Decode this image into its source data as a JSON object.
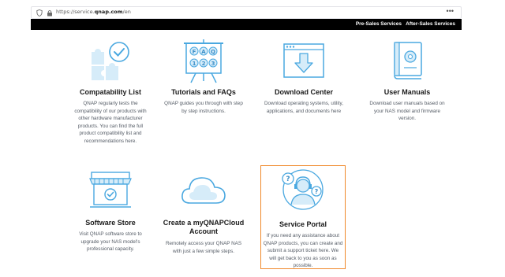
{
  "browser": {
    "url_prefix": "https://service.",
    "url_domain": "qnap.com",
    "url_path": "/en",
    "menu_glyph": "•••"
  },
  "topnav": {
    "pre_sales": "Pre-Sales Services",
    "after_sales": "After-Sales Services"
  },
  "cards": [
    {
      "title": "Compatability List",
      "icon": "puzzle-check-icon",
      "desc": [
        "QNAP regularly tests the",
        "compatibility of our products with",
        "other hardware manufacturer",
        "products. You can find the full",
        "product compatibility list and",
        "recommendations here."
      ]
    },
    {
      "title": "Tutorials and FAQs",
      "icon": "faq-board-icon",
      "desc": [
        "QNAP guides you through with step",
        "by step instructions."
      ]
    },
    {
      "title": "Download Center",
      "icon": "download-window-icon",
      "desc": [
        "Download operating systems, utility,",
        "applications, and documents here"
      ]
    },
    {
      "title": "User Manuals",
      "icon": "manual-book-icon",
      "desc": [
        "Download user manuals based on",
        "your NAS model and firmware",
        "version."
      ]
    },
    {
      "title": "Software Store",
      "icon": "store-icon",
      "desc": [
        "Visit QNAP software store to",
        "upgrade your NAS model's",
        "professional capacity."
      ]
    },
    {
      "title_lines": [
        "Create a myQNAPCloud",
        "Account"
      ],
      "icon": "cloud-icon",
      "desc": [
        "Remotely access your QNAP NAS",
        "with just a few simple steps."
      ]
    },
    {
      "title": "Service Portal",
      "icon": "support-agent-icon",
      "desc": [
        "If you need any assistance about",
        "QNAP products, you can create and",
        "submit a support ticket here. We",
        "will get back to you as soon as",
        "possible."
      ]
    }
  ],
  "colors": {
    "accent_blue": "#4aa8e0",
    "light_blue": "#d6ecf9",
    "highlight_orange": "#f08a2c",
    "nav_bar": "#000000"
  }
}
